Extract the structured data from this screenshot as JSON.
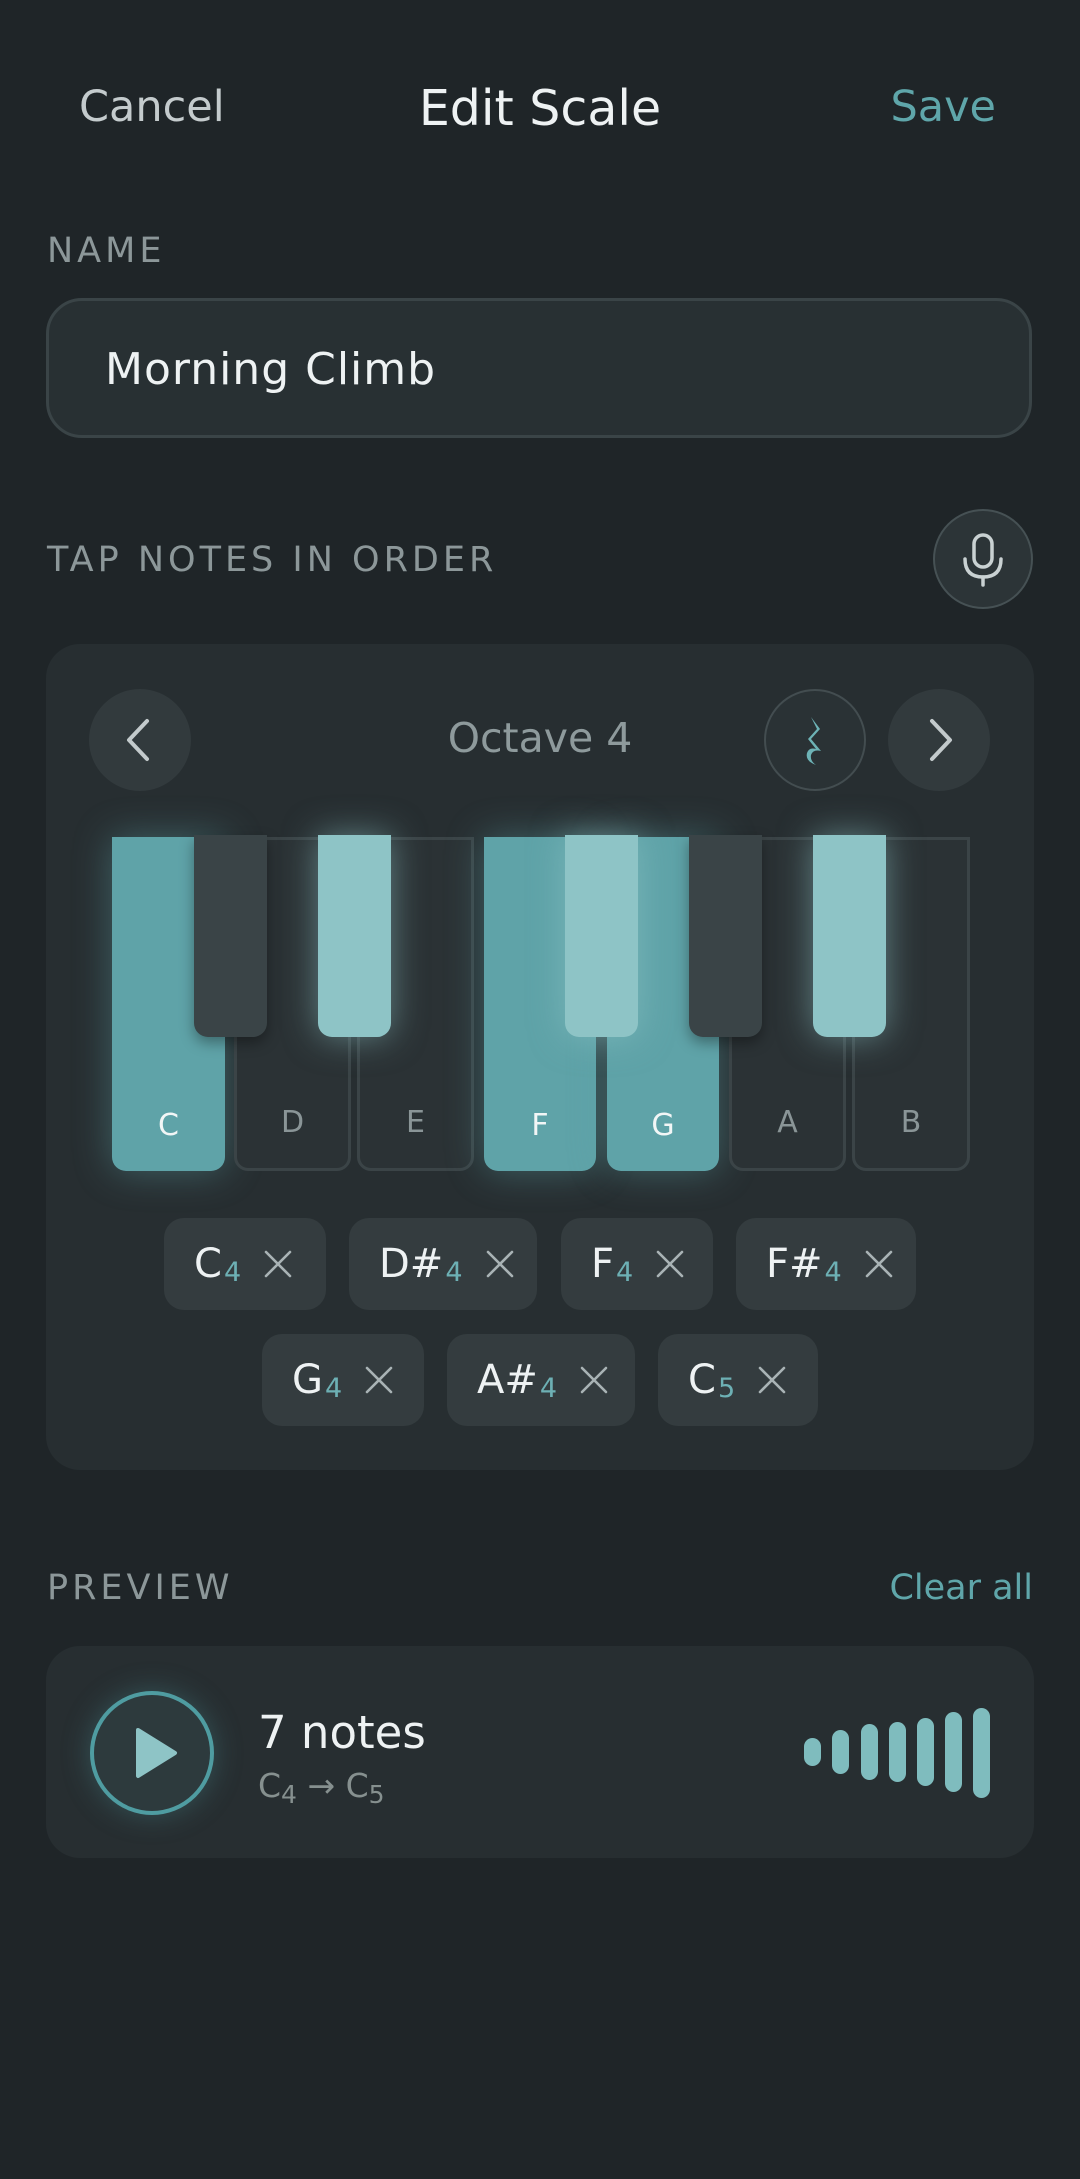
{
  "header": {
    "cancel_label": "Cancel",
    "title": "Edit Scale",
    "save_label": "Save"
  },
  "name_section": {
    "label": "NAME",
    "value": "Morning Climb"
  },
  "notes_section": {
    "label": "TAP NOTES IN ORDER",
    "mic_icon": "microphone-icon"
  },
  "keyboard": {
    "octave_label": "Octave 4",
    "rest_icon": "quarter-rest-icon",
    "white_keys": [
      {
        "label": "C",
        "active": true
      },
      {
        "label": "D",
        "active": false
      },
      {
        "label": "E",
        "active": false
      },
      {
        "label": "F",
        "active": true
      },
      {
        "label": "G",
        "active": true
      },
      {
        "label": "A",
        "active": false
      },
      {
        "label": "B",
        "active": false
      }
    ],
    "black_keys_active": [
      false,
      true,
      true,
      false,
      true
    ]
  },
  "chips": [
    {
      "note": "C",
      "octave": "4"
    },
    {
      "note": "D#",
      "octave": "4"
    },
    {
      "note": "F",
      "octave": "4"
    },
    {
      "note": "F#",
      "octave": "4"
    },
    {
      "note": "G",
      "octave": "4"
    },
    {
      "note": "A#",
      "octave": "4"
    },
    {
      "note": "C",
      "octave": "5"
    }
  ],
  "preview": {
    "label": "PREVIEW",
    "clear_label": "Clear all",
    "count_text": "7 notes",
    "range_start": "C",
    "range_start_oct": "4",
    "arrow": "→",
    "range_end": "C",
    "range_end_oct": "5"
  },
  "colors": {
    "accent": "#5fa6aa",
    "background": "#1f2528",
    "active_key": "#5fa3a8",
    "active_black_key": "#8ec4c6"
  }
}
